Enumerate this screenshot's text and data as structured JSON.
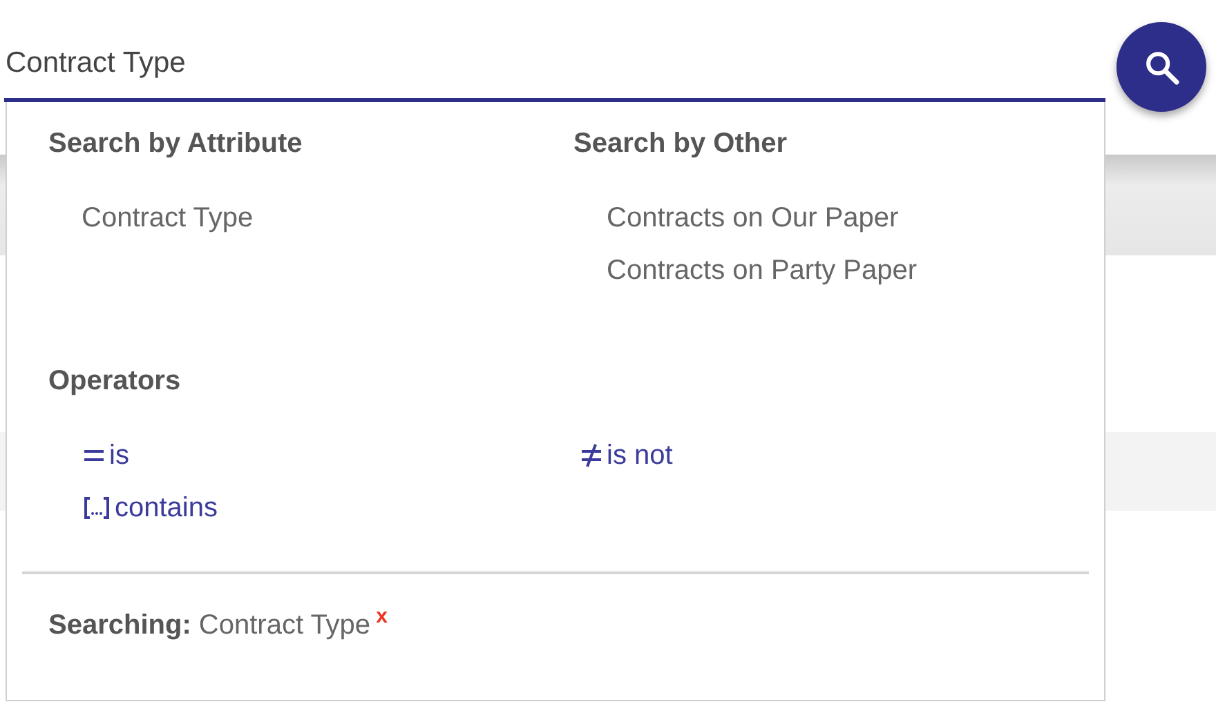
{
  "search": {
    "value": "Contract Type"
  },
  "dropdown": {
    "attribute_heading": "Search by Attribute",
    "attributes": [
      "Contract Type"
    ],
    "other_heading": "Search by Other",
    "others": [
      "Contracts on Our Paper",
      "Contracts on Party Paper"
    ],
    "operators_heading": "Operators",
    "operators": [
      {
        "kind": "equals",
        "label": "is"
      },
      {
        "kind": "not-equals",
        "label": "is not"
      },
      {
        "kind": "contains",
        "label": "contains"
      }
    ],
    "footer": {
      "label": "Searching:",
      "value": "Contract Type",
      "remove": "x"
    }
  }
}
